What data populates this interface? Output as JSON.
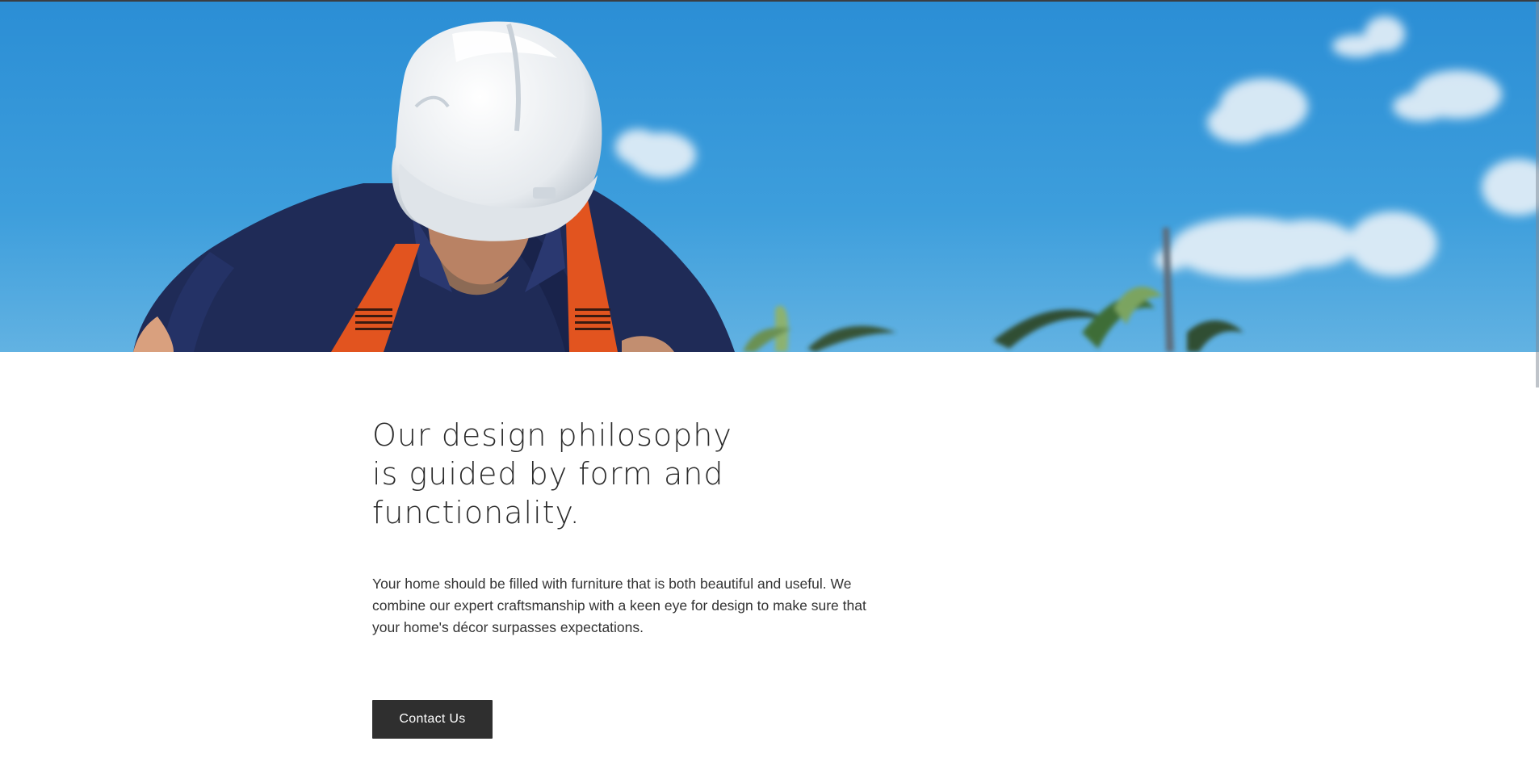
{
  "hero": {
    "image_label": "hero-image"
  },
  "main": {
    "headline": "Our design philosophy is guided by form and functionality.",
    "body": "Your home should be filled with furniture that is both beautiful and useful. We combine our expert craftsmanship with a keen eye for design to make sure that your home's décor surpasses expectations.",
    "button_label": "Contact Us"
  },
  "colors": {
    "sky": "#2f92d6",
    "shirt": "#1f2b57",
    "helmet": "#eef1f4",
    "harness": "#e2541f",
    "button_bg": "#2f2f2f",
    "text": "#2b2b2b"
  }
}
